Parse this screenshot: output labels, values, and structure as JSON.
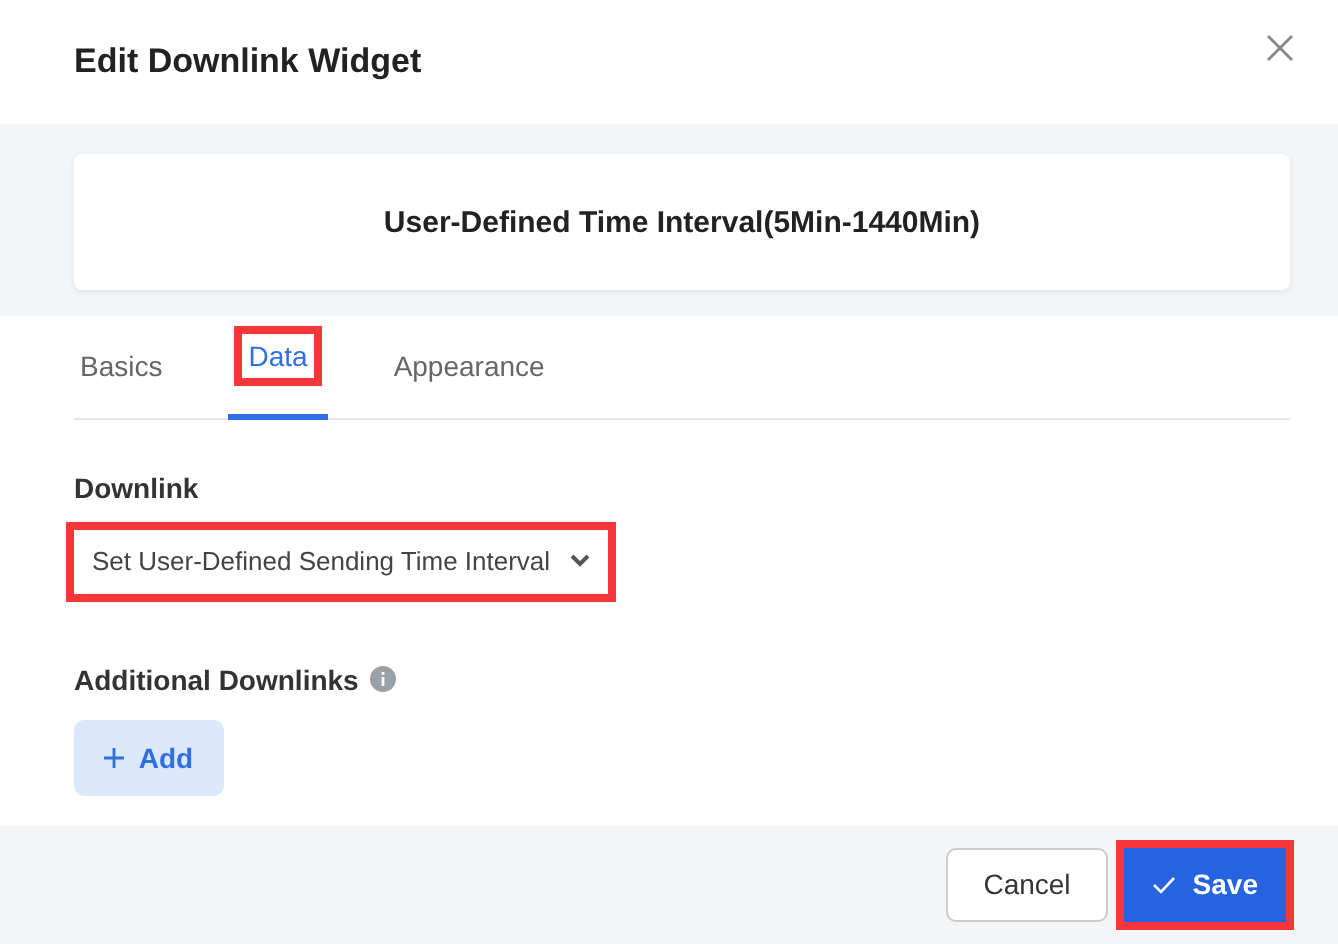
{
  "dialog": {
    "title": "Edit Downlink Widget"
  },
  "preview": {
    "title": "User-Defined Time Interval(5Min-1440Min)"
  },
  "tabs": [
    {
      "label": "Basics",
      "selected": false,
      "highlighted": false
    },
    {
      "label": "Data",
      "selected": true,
      "highlighted": true
    },
    {
      "label": "Appearance",
      "selected": false,
      "highlighted": false
    }
  ],
  "downlink": {
    "label": "Downlink",
    "value": "Set User-Defined Sending Time Interval",
    "highlighted": true
  },
  "additional": {
    "label": "Additional Downlinks",
    "add_button": "Add"
  },
  "buttons": [
    {
      "kind": "secondary",
      "label": "Cancel",
      "highlighted": false
    },
    {
      "kind": "primary",
      "label": "Save",
      "highlighted": true
    }
  ]
}
